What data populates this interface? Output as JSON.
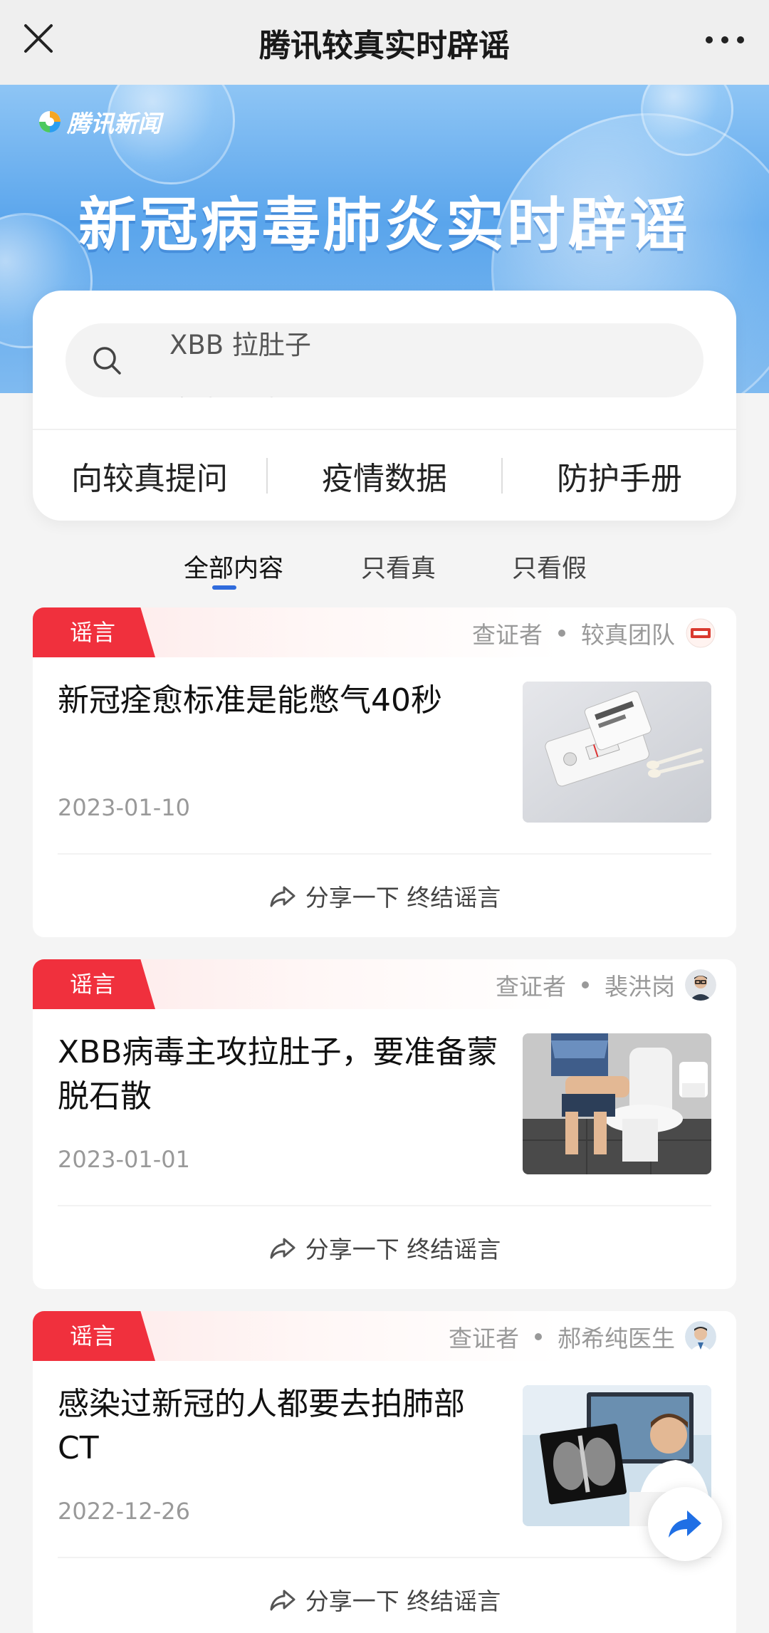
{
  "header": {
    "title": "腾讯较真实时辟谣"
  },
  "banner": {
    "brand": "腾讯新闻",
    "title": "新冠病毒肺炎实时辟谣"
  },
  "search": {
    "current_query": "XBB 拉肚子",
    "next_query": "发烧 退烧"
  },
  "quick_actions": [
    {
      "label": "向较真提问"
    },
    {
      "label": "疫情数据"
    },
    {
      "label": "防护手册"
    }
  ],
  "filter_tabs": [
    {
      "label": "全部内容",
      "active": true
    },
    {
      "label": "只看真",
      "active": false
    },
    {
      "label": "只看假",
      "active": false
    }
  ],
  "articles": [
    {
      "tag": "谣言",
      "verifier_label": "查证者",
      "verifier_name": "较真团队",
      "title": "新冠痊愈标准是能憋气40秒",
      "date": "2023-01-10",
      "share_label": "分享一下 终结谣言",
      "thumb_icon": "test-kit-photo"
    },
    {
      "tag": "谣言",
      "verifier_label": "查证者",
      "verifier_name": "裴洪岗",
      "title": "XBB病毒主攻拉肚子，要准备蒙脱石散",
      "date": "2023-01-01",
      "share_label": "分享一下 终结谣言",
      "thumb_icon": "toilet-photo"
    },
    {
      "tag": "谣言",
      "verifier_label": "查证者",
      "verifier_name": "郝希纯医生",
      "title": "感染过新冠的人都要去拍肺部CT",
      "date": "2022-12-26",
      "share_label": "分享一下 终结谣言",
      "thumb_icon": "xray-photo"
    }
  ],
  "colors": {
    "rumor_red": "#f0303d",
    "accent_blue": "#2f6bdc",
    "fab_blue": "#1f6fe5"
  }
}
